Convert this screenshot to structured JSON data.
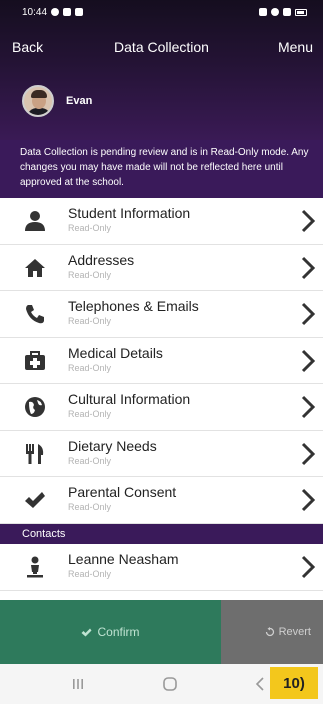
{
  "status_bar": {
    "time": "10:44"
  },
  "nav": {
    "back_label": "Back",
    "title": "Data Collection",
    "menu_label": "Menu"
  },
  "profile": {
    "name": "Evan"
  },
  "notice": "Data Collection is pending review and is in Read-Only mode. Any changes you may have made will not be reflected here until approved at the school.",
  "items": [
    {
      "label": "Student Information",
      "sub": "Read-Only",
      "icon": "person-icon"
    },
    {
      "label": "Addresses",
      "sub": "Read-Only",
      "icon": "home-icon"
    },
    {
      "label": "Telephones & Emails",
      "sub": "Read-Only",
      "icon": "phone-icon"
    },
    {
      "label": "Medical Details",
      "sub": "Read-Only",
      "icon": "medical-kit-icon"
    },
    {
      "label": "Cultural Information",
      "sub": "Read-Only",
      "icon": "globe-icon"
    },
    {
      "label": "Dietary Needs",
      "sub": "Read-Only",
      "icon": "cutlery-icon"
    },
    {
      "label": "Parental Consent",
      "sub": "Read-Only",
      "icon": "checkmark-icon"
    }
  ],
  "contacts": {
    "header": "Contacts",
    "items": [
      {
        "label": "Leanne Neasham",
        "sub": "Read-Only",
        "icon": "contact-person-icon"
      }
    ]
  },
  "actions": {
    "confirm_label": "Confirm",
    "revert_label": "Revert"
  },
  "badge": "10)",
  "colors": {
    "header_purple": "#3a1a5a",
    "confirm_green": "#2e7a5c",
    "revert_gray": "#6e6e6e",
    "badge_yellow": "#f3c71c"
  }
}
